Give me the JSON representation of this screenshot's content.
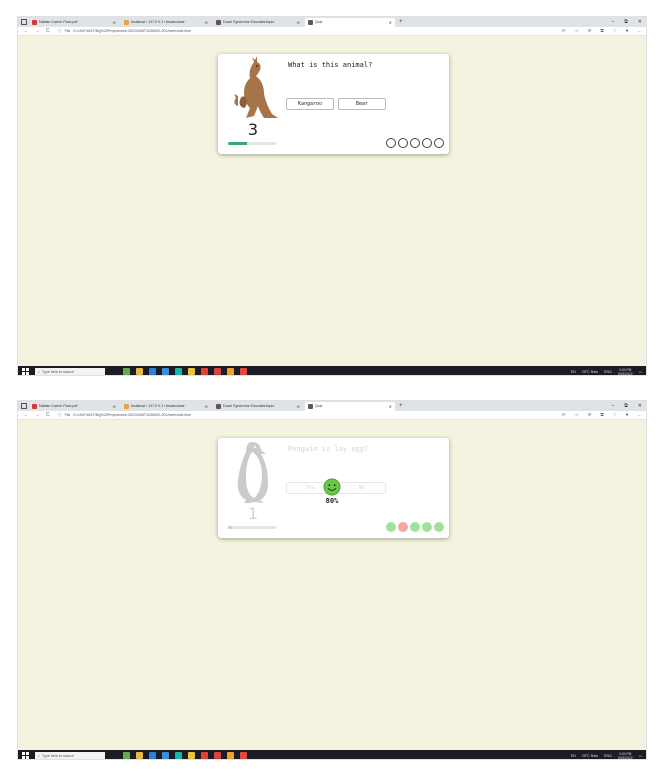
{
  "browser": {
    "tabs": [
      {
        "label": "Nabian Career Pack.pdf",
        "favicon_color": "#d23b2f"
      },
      {
        "label": "localhost / 127.0.0.1 / tesdeca/car",
        "favicon_color": "#e8a33d"
      },
      {
        "label": "Down Syndrome Education/quiz",
        "favicon_color": "#5a5a5a"
      },
      {
        "label": "Quiz",
        "favicon_color": "#5a5a5a",
        "active": true
      }
    ],
    "new_tab": "+",
    "window_controls": [
      "–",
      "⧉",
      "✕"
    ],
    "nav": [
      "←",
      "→",
      "C"
    ],
    "file_label": "File",
    "url": "D:/UMT/UMT/Big%20Project/web-20220408T104659Z-001/web/vivid.html",
    "tool_icons": [
      "A⁾",
      "☆",
      "⟳",
      "⧉",
      "♡",
      "●",
      "…"
    ]
  },
  "frames": [
    {
      "question": "What is this animal?",
      "answers": [
        "Kangaroo",
        "Bear"
      ],
      "counter": "3",
      "progress": 0.4,
      "dots": [
        "empty",
        "empty",
        "empty",
        "empty",
        "empty"
      ],
      "animal": "kangaroo"
    },
    {
      "question": "Penguin is lay egg?",
      "answers": [
        "Yes",
        "No"
      ],
      "counter": "1",
      "progress": 0.08,
      "dots": [
        "ok",
        "bad",
        "ok",
        "ok",
        "ok"
      ],
      "animal": "penguin",
      "feedback": {
        "icon": "smiley-icon",
        "score": "80%"
      }
    }
  ],
  "taskbar": {
    "search_placeholder": "Type here to search",
    "weather": "29°C Rain",
    "language": "ENG",
    "time": "3:00 PM",
    "date": "5/25/2022",
    "keyboard": "EN",
    "app_colors": [
      "#6aa84f",
      "#e9b64a",
      "#2d7fd3",
      "#3a8ed8",
      "#1db4a4",
      "#e8c342",
      "#e0413b",
      "#d6453b",
      "#f0a030",
      "#e24b3b"
    ]
  },
  "colors": {
    "page_bg": "#f3f3df",
    "progress": "#3aa876",
    "correct": "#9fe39a",
    "wrong": "#f3a7a7",
    "smiley": "#69c749"
  }
}
